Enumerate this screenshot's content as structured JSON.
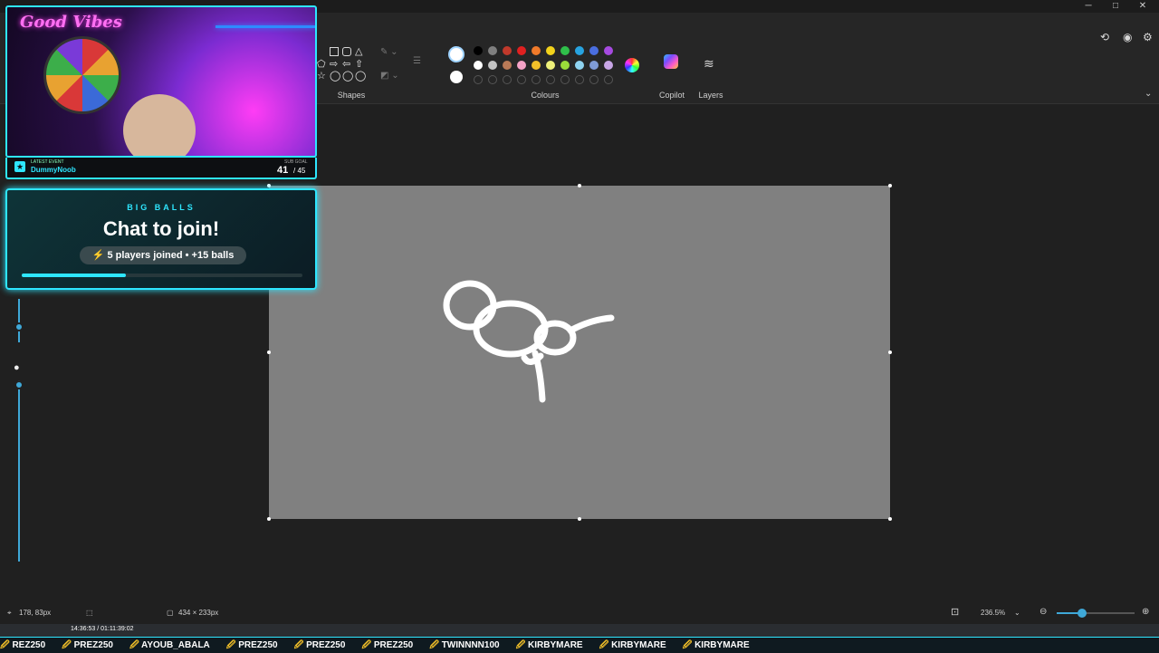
{
  "app": {
    "window_controls": {
      "minimize": "─",
      "maximize": "□",
      "close": "✕"
    }
  },
  "ribbon": {
    "shapes_label": "Shapes",
    "colours_label": "Colours",
    "copilot_label": "Copilot",
    "layers_label": "Layers",
    "colour_row1": [
      "#000000",
      "#7f7f7f",
      "#c0392b",
      "#e02020",
      "#f07a2a",
      "#f2d21b",
      "#2fbf4a",
      "#27a3e0",
      "#4a6ee0",
      "#a64ae0"
    ],
    "colour_row2": [
      "#ffffff",
      "#c3c3c3",
      "#b97a57",
      "#f5a3c7",
      "#f2c029",
      "#eef07a",
      "#9bdc3a",
      "#8fd3f0",
      "#7f9bd6",
      "#c8a6e6"
    ],
    "primary_colour": "#ffffff",
    "secondary_colour": "#ffffff"
  },
  "status": {
    "cursor_pos": "178, 83px",
    "canvas_size": "434 × 233px",
    "zoom": "236.5%",
    "zoom_level": 0.33
  },
  "stream": {
    "neon_sign": "Good Vibes",
    "latest_event_label": "LATEST EVENT",
    "latest_event_user": "DummyNoob",
    "goal_label": "SUB GOAL",
    "goal_current": "41",
    "goal_total": "/ 45",
    "card_kicker": "BIG BALLS",
    "card_title": "Chat to join!",
    "card_pill": "5 players joined • +15 balls",
    "card_progress": 0.37,
    "ticker_time": "14:36:53 / 01:11:39:02",
    "ticker": [
      "REZ250",
      "PREZ250",
      "AYOUB_ABALA",
      "PREZ250",
      "PREZ250",
      "PREZ250",
      "TWINNNN100",
      "KIRBYMARE",
      "KIRBYMARE",
      "KIRBYMARE"
    ]
  }
}
